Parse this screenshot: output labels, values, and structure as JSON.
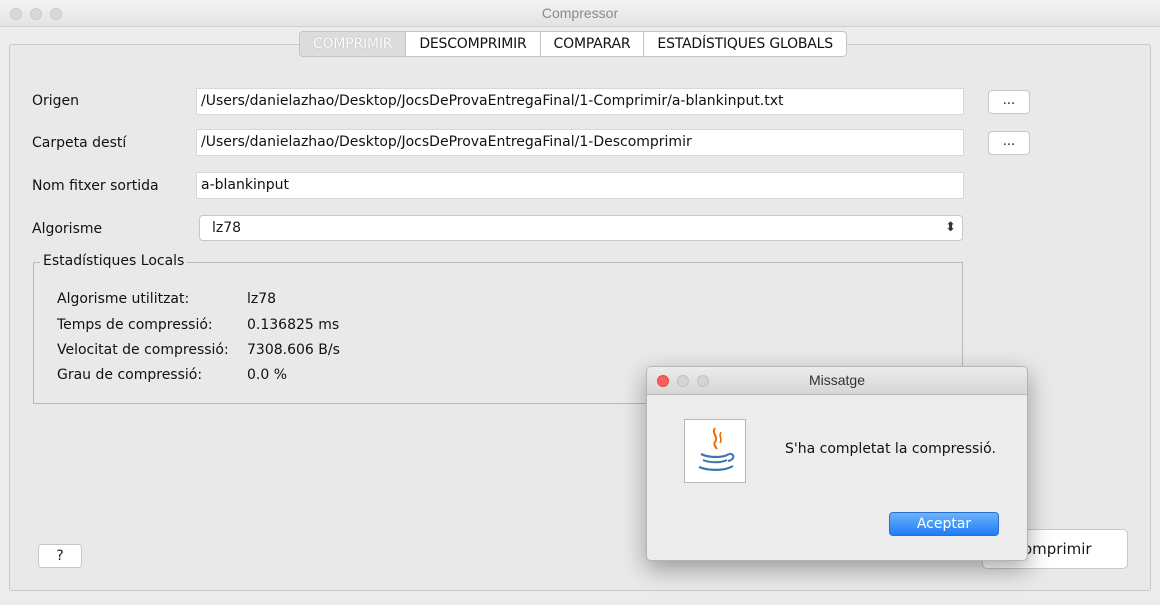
{
  "window": {
    "title": "Compressor"
  },
  "tabs": [
    {
      "label": "COMPRIMIR",
      "active": true
    },
    {
      "label": "DESCOMPRIMIR",
      "active": false
    },
    {
      "label": "COMPARAR",
      "active": false
    },
    {
      "label": "ESTADÍSTIQUES GLOBALS",
      "active": false
    }
  ],
  "form": {
    "origin_label": "Origen",
    "origin_value": "/Users/danielazhao/Desktop/JocsDeProvaEntregaFinal/1-Comprimir/a-blankinput.txt",
    "origin_browse": "...",
    "dest_label": "Carpeta destí",
    "dest_value": "/Users/danielazhao/Desktop/JocsDeProvaEntregaFinal/1-Descomprimir",
    "dest_browse": "...",
    "output_label": "Nom fitxer sortida",
    "output_value": "a-blankinput",
    "algorithm_label": "Algorisme",
    "algorithm_value": "lz78"
  },
  "stats": {
    "title": "Estadístiques Locals",
    "rows": [
      {
        "label": "Algorisme utilitzat:",
        "value": "lz78"
      },
      {
        "label": "Temps de compressió:",
        "value": "0.136825 ms"
      },
      {
        "label": "Velocitat de compressió:",
        "value": "7308.606 B/s"
      },
      {
        "label": "Grau de compressió:",
        "value": "0.0 %"
      }
    ]
  },
  "footer": {
    "help_label": "?",
    "action_label": "omprimir"
  },
  "dialog": {
    "title": "Missatge",
    "message": "S'ha completat la compressió.",
    "accept_label": "Aceptar",
    "icon": "java-icon"
  },
  "colors": {
    "accent": "#1f7cf5",
    "close_dot": "#fc605c"
  }
}
